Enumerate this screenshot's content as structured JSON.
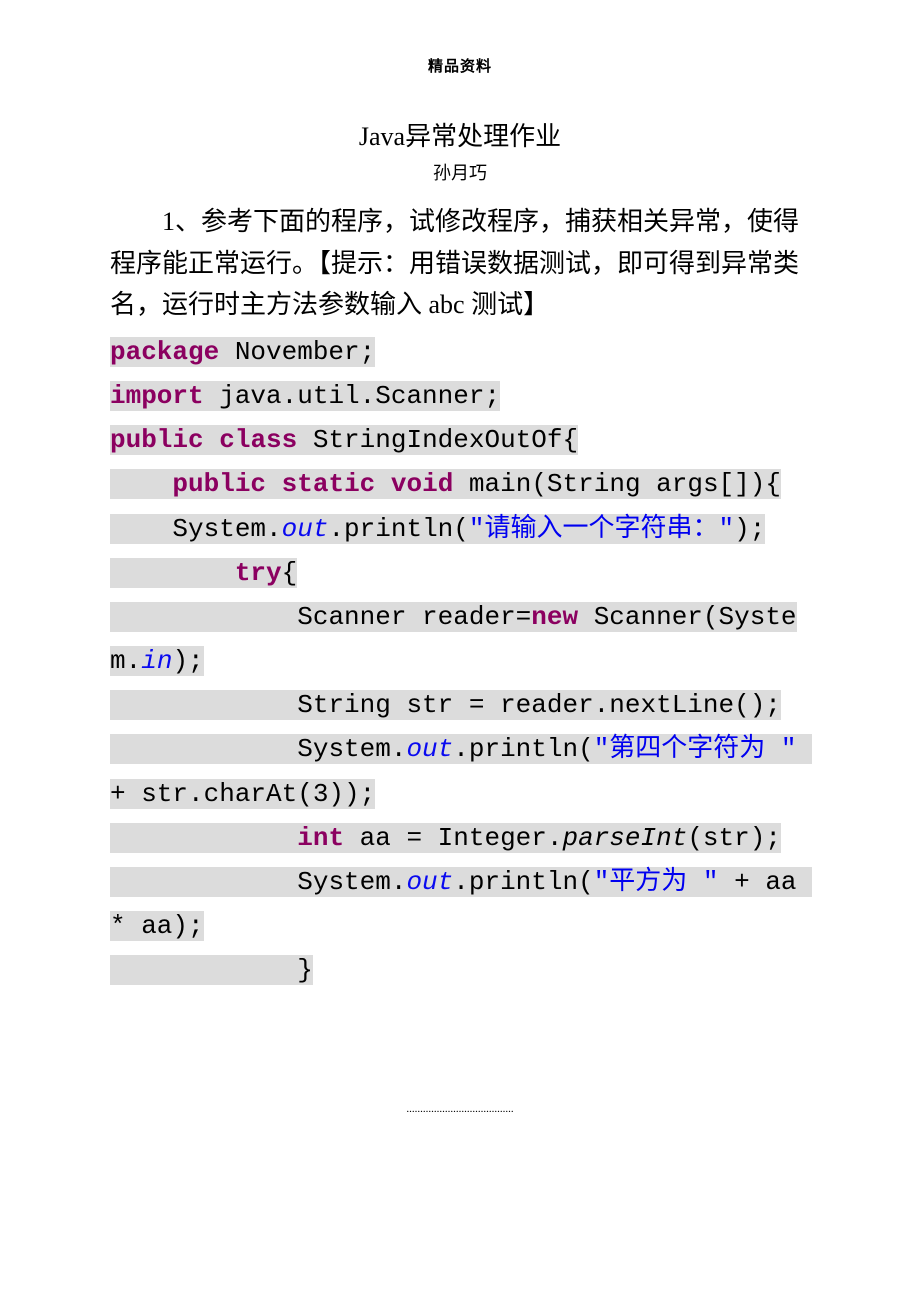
{
  "header": {
    "label": "精品资料"
  },
  "title": "Java异常处理作业",
  "author": "孙月巧",
  "question": "1、参考下面的程序，试修改程序，捕获相关异常，使得程序能正常运行。【提示：用错误数据测试，即可得到异常类名，运行时主方法参数输入 abc 测试】",
  "code": {
    "t1": "package",
    "t2": " November;",
    "t3": "import",
    "t4": " java.util.Scanner;",
    "t5": "public",
    "t6": " ",
    "t7": "class",
    "t8": " StringIndexOutOf{",
    "t9": "    ",
    "t10": "public",
    "t11": " ",
    "t12": "static",
    "t13": " ",
    "t14": "void",
    "t15": " main(String args[]){",
    "t16": "    System.",
    "t17": "out",
    "t18": ".println(",
    "t19": "\"请输入一个字符串：\"",
    "t20": ");",
    "t21": "        ",
    "t22": "try",
    "t23": "{",
    "t24": "            Scanner reader=",
    "t25": "new",
    "t26": " Scanner(System.",
    "t27": "in",
    "t28": ");",
    "t29": "            String str = reader.nextLine();",
    "t30": "            System.",
    "t31": "out",
    "t32": ".println(",
    "t33": "\"第四个字符为 \"",
    "t34": " + str.charAt(3));",
    "t35": "            ",
    "t36": "int",
    "t37": " aa = Integer.",
    "t38": "parseInt",
    "t39": "(str);",
    "t40": "            System.",
    "t41": "out",
    "t42": ".println(",
    "t43": "\"平方为 \"",
    "t44": " + aa * aa);",
    "t45": "            }"
  },
  "footer": {
    "dots": "......................................."
  }
}
